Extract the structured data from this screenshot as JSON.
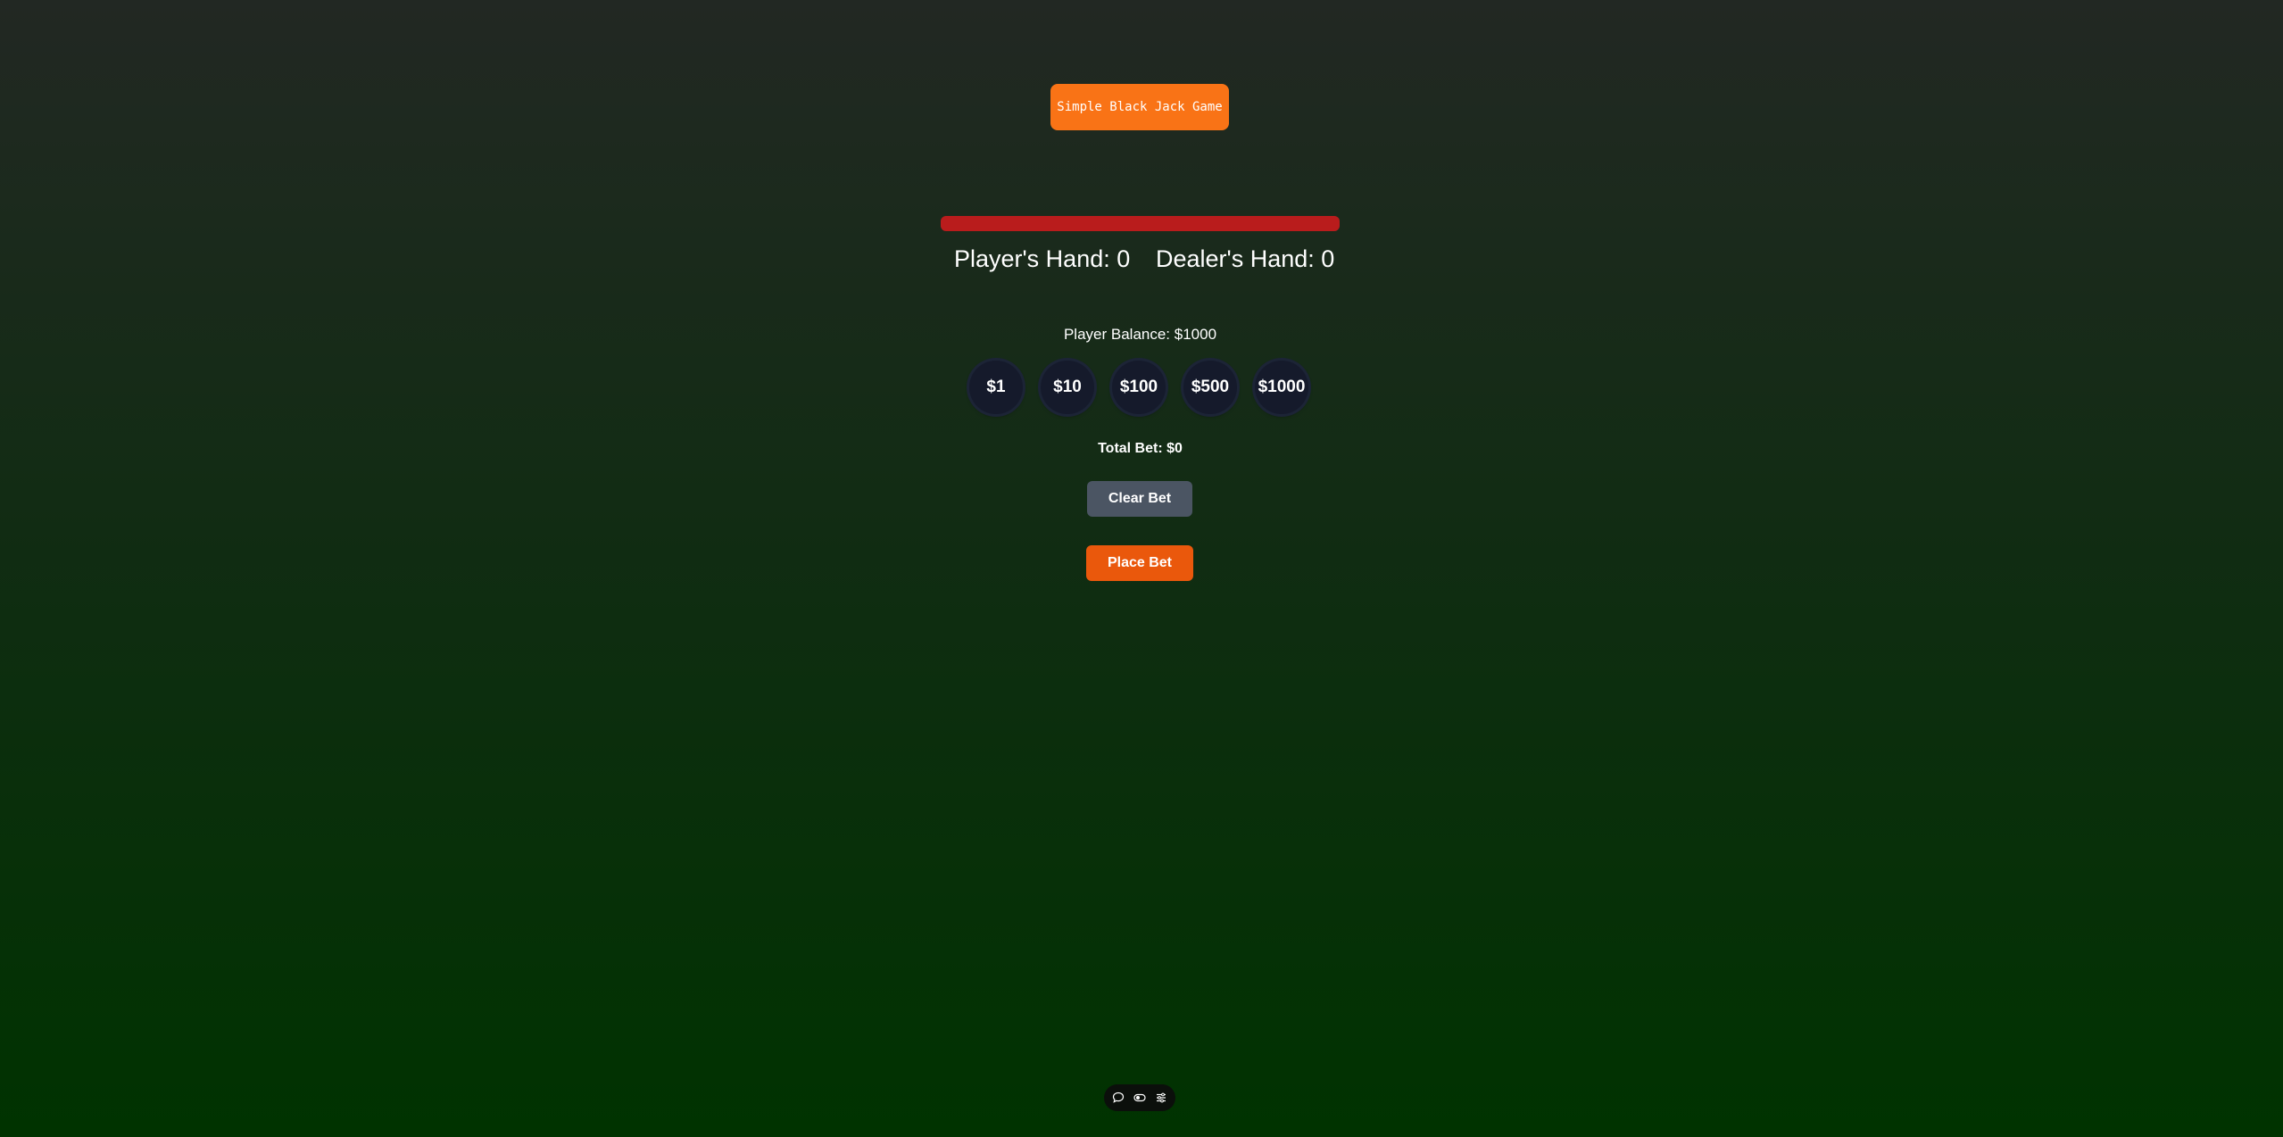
{
  "header": {
    "title_button_label": "Simple Black Jack Game"
  },
  "hands": {
    "player_label": "Player's Hand: 0",
    "dealer_label": "Dealer's Hand: 0"
  },
  "balance": {
    "label": "Player Balance: $1000"
  },
  "chips": [
    "$1",
    "$10",
    "$100",
    "$500",
    "$1000"
  ],
  "bet": {
    "total_label": "Total Bet: $0",
    "clear_label": "Clear Bet",
    "place_label": "Place Bet"
  },
  "toolbar": {
    "icons": [
      "chat-icon",
      "toggle-icon",
      "sliders-icon"
    ]
  },
  "colors": {
    "title_button": "#f97316",
    "status_bar": "#b91c1c",
    "chip": "#151a2b",
    "clear_button": "#4b5563",
    "place_button": "#ea580c"
  }
}
